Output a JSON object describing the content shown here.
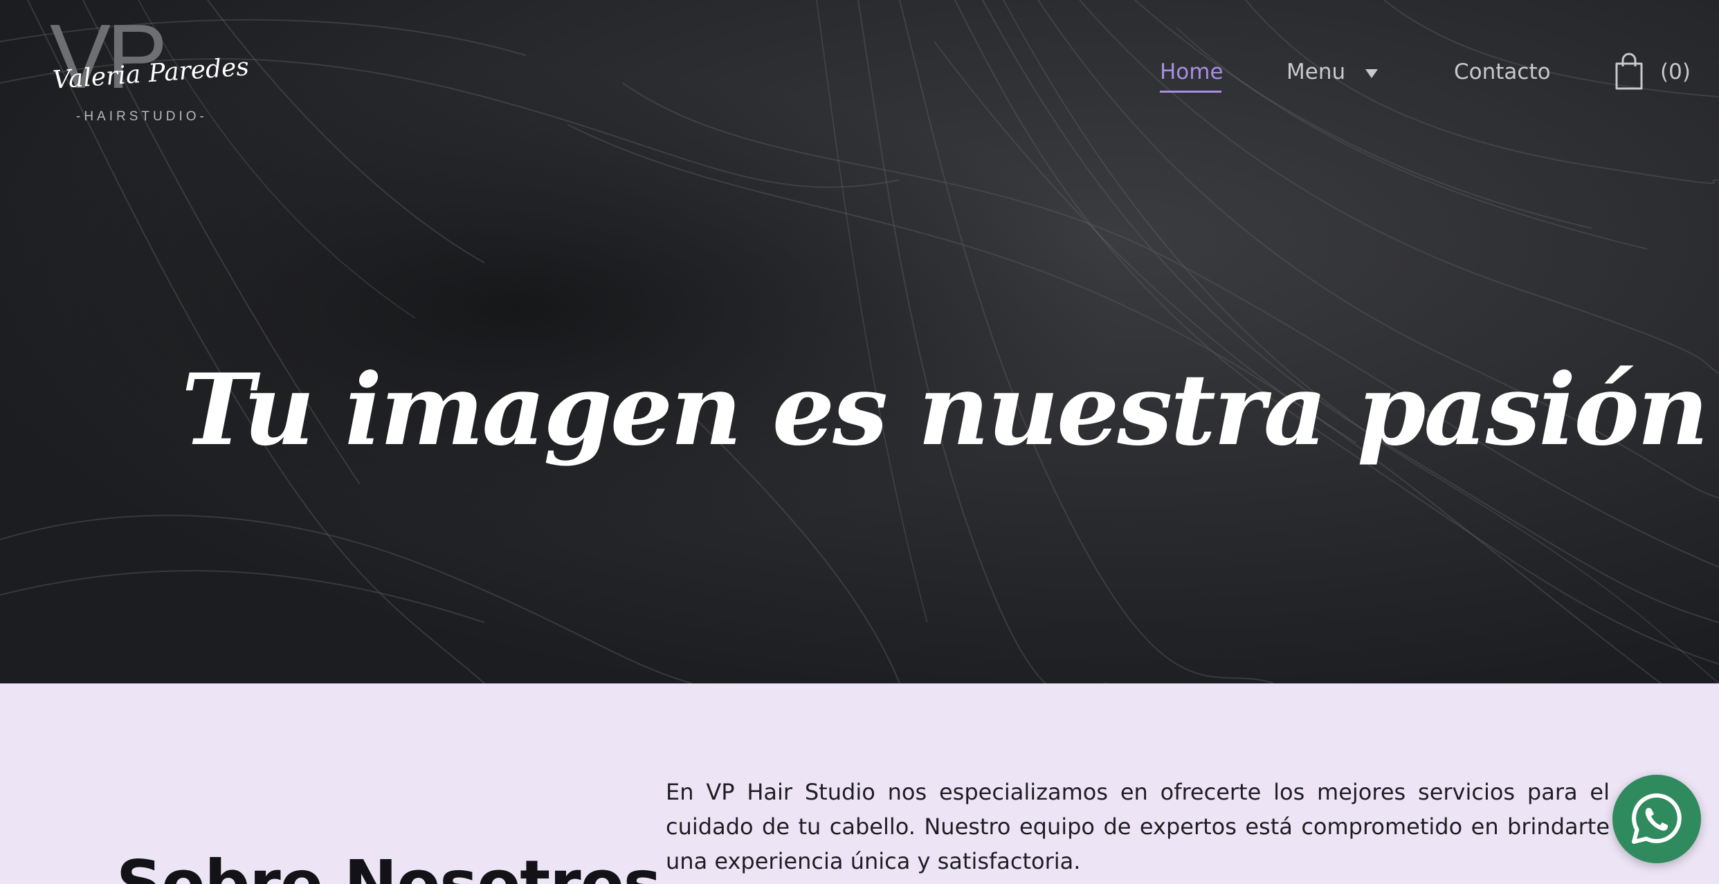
{
  "brand": {
    "monogram": "VP",
    "script_name": "Valeria Paredes",
    "subtitle": "-HAIRSTUDIO-"
  },
  "nav": {
    "items": [
      {
        "label": "Home",
        "active": true
      },
      {
        "label": "Menu",
        "has_dropdown": true
      },
      {
        "label": "Contacto"
      }
    ],
    "cart_count": "(0)",
    "active_color": "#a98ee3"
  },
  "hero": {
    "headline": "Tu imagen es nuestra pasión"
  },
  "about": {
    "title": "Sobre Nosotros",
    "text": "En VP Hair Studio nos especializamos en ofrecerte los mejores servicios para el cuidado de tu cabello. Nuestro equipo de expertos está comprometido en brindarte una experiencia única y satisfactoria.",
    "background": "#ede5f5"
  },
  "floating": {
    "whatsapp_icon": "whatsapp-icon",
    "whatsapp_color": "#2f8a5e"
  }
}
